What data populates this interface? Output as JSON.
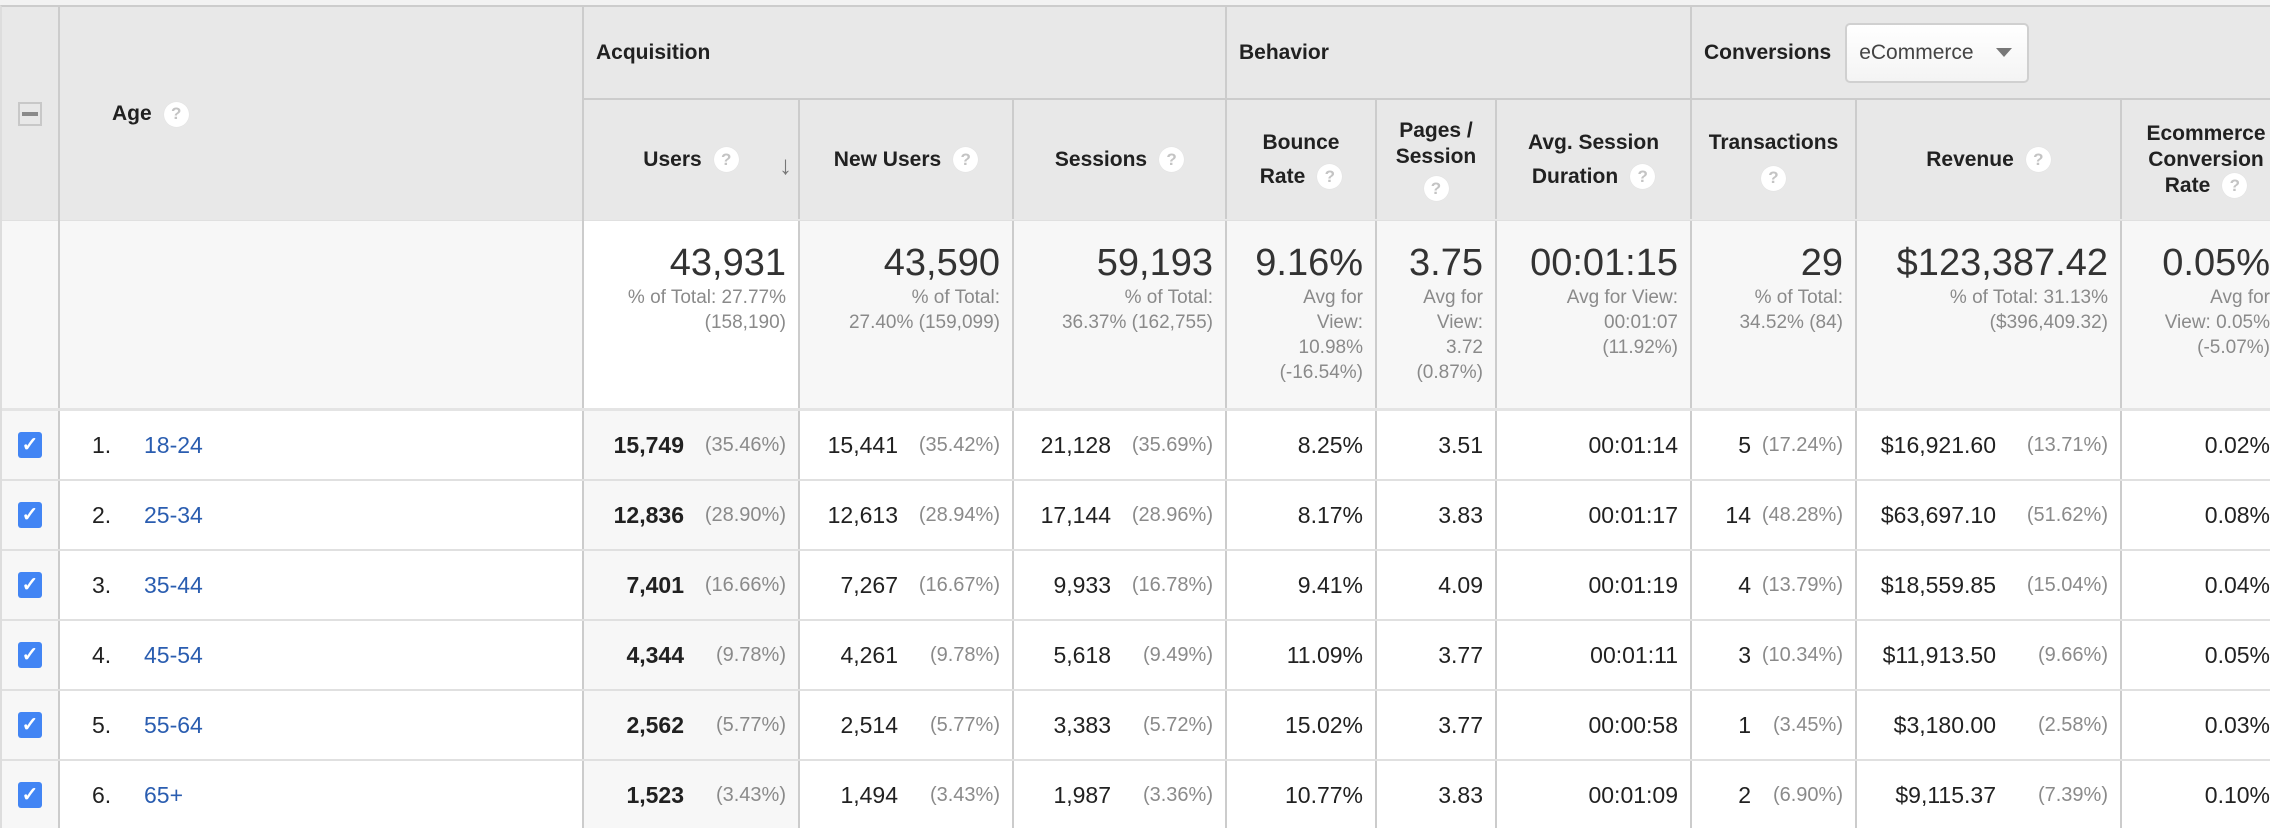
{
  "header": {
    "select_all_state": "partial",
    "dimension": {
      "label": "Age",
      "help_icon": "question-circle-icon"
    },
    "groups": [
      {
        "label": "Acquisition"
      },
      {
        "label": "Behavior"
      },
      {
        "label": "Conversions",
        "dropdown": {
          "selected": "eCommerce",
          "icon": "caret-down-icon"
        }
      }
    ],
    "metrics": [
      {
        "key": "users",
        "label": "Users",
        "sorted": "descending",
        "sort_icon": "arrow-down-icon"
      },
      {
        "key": "new_users",
        "label": "New Users"
      },
      {
        "key": "sessions",
        "label": "Sessions"
      },
      {
        "key": "bounce_rate",
        "label": "Bounce Rate"
      },
      {
        "key": "pages_session",
        "label": "Pages / Session"
      },
      {
        "key": "avg_session_duration",
        "label": "Avg. Session Duration"
      },
      {
        "key": "transactions",
        "label": "Transactions"
      },
      {
        "key": "revenue",
        "label": "Revenue"
      },
      {
        "key": "ecommerce_conversion_rate",
        "label": "Ecommerce Conversion Rate"
      }
    ]
  },
  "summary": {
    "users": {
      "value": "43,931",
      "line1": "% of Total: 27.77%",
      "line2": "(158,190)"
    },
    "new_users": {
      "value": "43,590",
      "line1": "% of Total:",
      "line2": "27.40% (159,099)"
    },
    "sessions": {
      "value": "59,193",
      "line1": "% of Total:",
      "line2": "36.37% (162,755)"
    },
    "bounce_rate": {
      "value": "9.16%",
      "line1": "Avg for",
      "line2": "View:",
      "line3": "10.98%",
      "line4": "(-16.54%)"
    },
    "pages_session": {
      "value": "3.75",
      "line1": "Avg for",
      "line2": "View:",
      "line3": "3.72",
      "line4": "(0.87%)"
    },
    "avg_session_duration": {
      "value": "00:01:15",
      "line1": "Avg for View:",
      "line2": "00:01:07",
      "line3": "(11.92%)"
    },
    "transactions": {
      "value": "29",
      "line1": "% of Total:",
      "line2": "34.52% (84)"
    },
    "revenue": {
      "value": "$123,387.42",
      "line1": "% of Total: 31.13%",
      "line2": "($396,409.32)"
    },
    "ecommerce_conversion_rate": {
      "value": "0.05%",
      "line1": "Avg for",
      "line2": "View: 0.05%",
      "line3": "(-5.07%)"
    }
  },
  "rows": [
    {
      "checked": true,
      "index": "1.",
      "age": "18-24",
      "users": "15,749",
      "users_pct": "(35.46%)",
      "new_users": "15,441",
      "new_users_pct": "(35.42%)",
      "sessions": "21,128",
      "sessions_pct": "(35.69%)",
      "bounce_rate": "8.25%",
      "pages_session": "3.51",
      "avg_session_duration": "00:01:14",
      "transactions": "5",
      "transactions_pct": "(17.24%)",
      "revenue": "$16,921.60",
      "revenue_pct": "(13.71%)",
      "ecommerce_conversion_rate": "0.02%"
    },
    {
      "checked": true,
      "index": "2.",
      "age": "25-34",
      "users": "12,836",
      "users_pct": "(28.90%)",
      "new_users": "12,613",
      "new_users_pct": "(28.94%)",
      "sessions": "17,144",
      "sessions_pct": "(28.96%)",
      "bounce_rate": "8.17%",
      "pages_session": "3.83",
      "avg_session_duration": "00:01:17",
      "transactions": "14",
      "transactions_pct": "(48.28%)",
      "revenue": "$63,697.10",
      "revenue_pct": "(51.62%)",
      "ecommerce_conversion_rate": "0.08%"
    },
    {
      "checked": true,
      "index": "3.",
      "age": "35-44",
      "users": "7,401",
      "users_pct": "(16.66%)",
      "new_users": "7,267",
      "new_users_pct": "(16.67%)",
      "sessions": "9,933",
      "sessions_pct": "(16.78%)",
      "bounce_rate": "9.41%",
      "pages_session": "4.09",
      "avg_session_duration": "00:01:19",
      "transactions": "4",
      "transactions_pct": "(13.79%)",
      "revenue": "$18,559.85",
      "revenue_pct": "(15.04%)",
      "ecommerce_conversion_rate": "0.04%"
    },
    {
      "checked": true,
      "index": "4.",
      "age": "45-54",
      "users": "4,344",
      "users_pct": "(9.78%)",
      "new_users": "4,261",
      "new_users_pct": "(9.78%)",
      "sessions": "5,618",
      "sessions_pct": "(9.49%)",
      "bounce_rate": "11.09%",
      "pages_session": "3.77",
      "avg_session_duration": "00:01:11",
      "transactions": "3",
      "transactions_pct": "(10.34%)",
      "revenue": "$11,913.50",
      "revenue_pct": "(9.66%)",
      "ecommerce_conversion_rate": "0.05%"
    },
    {
      "checked": true,
      "index": "5.",
      "age": "55-64",
      "users": "2,562",
      "users_pct": "(5.77%)",
      "new_users": "2,514",
      "new_users_pct": "(5.77%)",
      "sessions": "3,383",
      "sessions_pct": "(5.72%)",
      "bounce_rate": "15.02%",
      "pages_session": "3.77",
      "avg_session_duration": "00:00:58",
      "transactions": "1",
      "transactions_pct": "(3.45%)",
      "revenue": "$3,180.00",
      "revenue_pct": "(2.58%)",
      "ecommerce_conversion_rate": "0.03%"
    },
    {
      "checked": true,
      "index": "6.",
      "age": "65+",
      "users": "1,523",
      "users_pct": "(3.43%)",
      "new_users": "1,494",
      "new_users_pct": "(3.43%)",
      "sessions": "1,987",
      "sessions_pct": "(3.36%)",
      "bounce_rate": "10.77%",
      "pages_session": "3.83",
      "avg_session_duration": "00:01:09",
      "transactions": "2",
      "transactions_pct": "(6.90%)",
      "revenue": "$9,115.37",
      "revenue_pct": "(7.39%)",
      "ecommerce_conversion_rate": "0.10%"
    }
  ],
  "colors": {
    "link": "#2a5db0",
    "checkbox": "#4285f4",
    "header_bg": "#e8e8e8",
    "muted_text": "#8a8a8a"
  }
}
